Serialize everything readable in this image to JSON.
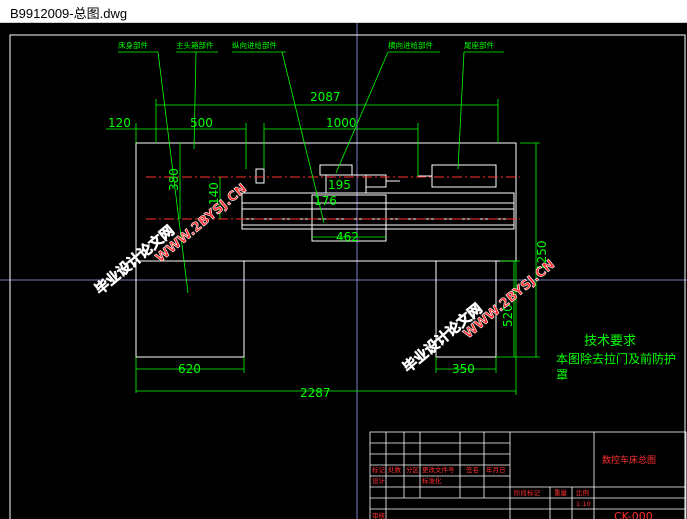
{
  "window": {
    "title": "B9912009-总图.dwg"
  },
  "drawing": {
    "part_labels": [
      "床身部件",
      "主头箱部件",
      "纵向进给部件",
      "横向进给部件",
      "尾座部件"
    ],
    "dims": {
      "overall_top": "2087",
      "left_120": "120",
      "left_500": "500",
      "mid_1000": "1000",
      "v_380": "380",
      "v_140": "140",
      "d_195": "195",
      "d_176": "176",
      "d_462": "462",
      "v_1250": "1250",
      "v_520": "520",
      "bottom_620": "620",
      "bottom_350": "350",
      "overall_bottom": "2287"
    },
    "tech": {
      "heading": "技术要求",
      "line1": "本图除去拉门及前防护",
      "line2": "罩"
    },
    "watermarks": [
      "毕业设计论文网",
      "WWW.2BYSJ.CN"
    ],
    "title_block": {
      "row1": [
        "标记",
        "处数",
        "分区",
        "更改文件号",
        "签名",
        "年月日"
      ],
      "row2": [
        "设计",
        "",
        "",
        "标准化",
        "",
        ""
      ],
      "row3": [
        "审核"
      ],
      "stage": "阶段标记",
      "weight": "重量",
      "scale": "比例",
      "scale_value": "1:10",
      "name": "数控车床总图",
      "code": "CK-000"
    }
  },
  "colors": {
    "green": "#00ff00",
    "white": "#ffffff",
    "red": "#ff3030",
    "cyan": "#00ffff",
    "wm": "#ff2a2a"
  }
}
